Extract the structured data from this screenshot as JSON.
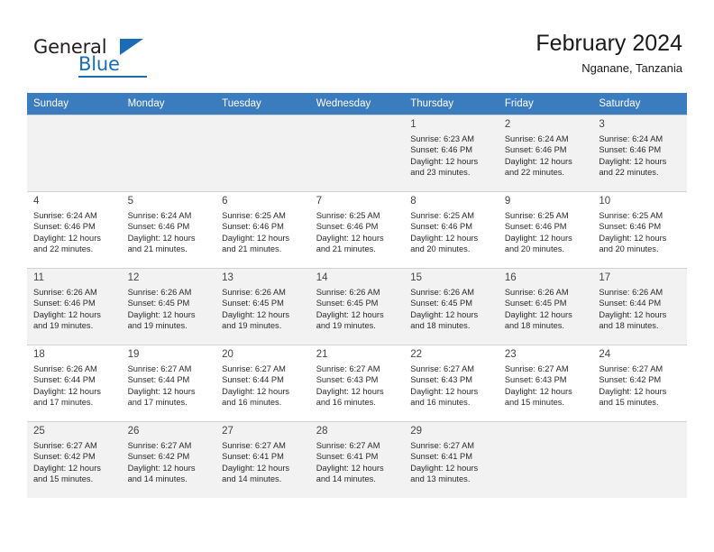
{
  "brand": {
    "name_top": "General",
    "name_bottom": "Blue",
    "accent_color": "#1b6cb5"
  },
  "header": {
    "title": "February 2024",
    "subtitle": "Nganane, Tanzania"
  },
  "calendar": {
    "header_bg": "#3a7cbe",
    "weekday_headers": [
      "Sunday",
      "Monday",
      "Tuesday",
      "Wednesday",
      "Thursday",
      "Friday",
      "Saturday"
    ],
    "weeks": [
      [
        {
          "day": "",
          "info": "",
          "empty": true
        },
        {
          "day": "",
          "info": "",
          "empty": true
        },
        {
          "day": "",
          "info": "",
          "empty": true
        },
        {
          "day": "",
          "info": "",
          "empty": true
        },
        {
          "day": "1",
          "info": "Sunrise: 6:23 AM\nSunset: 6:46 PM\nDaylight: 12 hours\nand 23 minutes."
        },
        {
          "day": "2",
          "info": "Sunrise: 6:24 AM\nSunset: 6:46 PM\nDaylight: 12 hours\nand 22 minutes."
        },
        {
          "day": "3",
          "info": "Sunrise: 6:24 AM\nSunset: 6:46 PM\nDaylight: 12 hours\nand 22 minutes."
        }
      ],
      [
        {
          "day": "4",
          "info": "Sunrise: 6:24 AM\nSunset: 6:46 PM\nDaylight: 12 hours\nand 22 minutes."
        },
        {
          "day": "5",
          "info": "Sunrise: 6:24 AM\nSunset: 6:46 PM\nDaylight: 12 hours\nand 21 minutes."
        },
        {
          "day": "6",
          "info": "Sunrise: 6:25 AM\nSunset: 6:46 PM\nDaylight: 12 hours\nand 21 minutes."
        },
        {
          "day": "7",
          "info": "Sunrise: 6:25 AM\nSunset: 6:46 PM\nDaylight: 12 hours\nand 21 minutes."
        },
        {
          "day": "8",
          "info": "Sunrise: 6:25 AM\nSunset: 6:46 PM\nDaylight: 12 hours\nand 20 minutes."
        },
        {
          "day": "9",
          "info": "Sunrise: 6:25 AM\nSunset: 6:46 PM\nDaylight: 12 hours\nand 20 minutes."
        },
        {
          "day": "10",
          "info": "Sunrise: 6:25 AM\nSunset: 6:46 PM\nDaylight: 12 hours\nand 20 minutes."
        }
      ],
      [
        {
          "day": "11",
          "info": "Sunrise: 6:26 AM\nSunset: 6:46 PM\nDaylight: 12 hours\nand 19 minutes."
        },
        {
          "day": "12",
          "info": "Sunrise: 6:26 AM\nSunset: 6:45 PM\nDaylight: 12 hours\nand 19 minutes."
        },
        {
          "day": "13",
          "info": "Sunrise: 6:26 AM\nSunset: 6:45 PM\nDaylight: 12 hours\nand 19 minutes."
        },
        {
          "day": "14",
          "info": "Sunrise: 6:26 AM\nSunset: 6:45 PM\nDaylight: 12 hours\nand 19 minutes."
        },
        {
          "day": "15",
          "info": "Sunrise: 6:26 AM\nSunset: 6:45 PM\nDaylight: 12 hours\nand 18 minutes."
        },
        {
          "day": "16",
          "info": "Sunrise: 6:26 AM\nSunset: 6:45 PM\nDaylight: 12 hours\nand 18 minutes."
        },
        {
          "day": "17",
          "info": "Sunrise: 6:26 AM\nSunset: 6:44 PM\nDaylight: 12 hours\nand 18 minutes."
        }
      ],
      [
        {
          "day": "18",
          "info": "Sunrise: 6:26 AM\nSunset: 6:44 PM\nDaylight: 12 hours\nand 17 minutes."
        },
        {
          "day": "19",
          "info": "Sunrise: 6:27 AM\nSunset: 6:44 PM\nDaylight: 12 hours\nand 17 minutes."
        },
        {
          "day": "20",
          "info": "Sunrise: 6:27 AM\nSunset: 6:44 PM\nDaylight: 12 hours\nand 16 minutes."
        },
        {
          "day": "21",
          "info": "Sunrise: 6:27 AM\nSunset: 6:43 PM\nDaylight: 12 hours\nand 16 minutes."
        },
        {
          "day": "22",
          "info": "Sunrise: 6:27 AM\nSunset: 6:43 PM\nDaylight: 12 hours\nand 16 minutes."
        },
        {
          "day": "23",
          "info": "Sunrise: 6:27 AM\nSunset: 6:43 PM\nDaylight: 12 hours\nand 15 minutes."
        },
        {
          "day": "24",
          "info": "Sunrise: 6:27 AM\nSunset: 6:42 PM\nDaylight: 12 hours\nand 15 minutes."
        }
      ],
      [
        {
          "day": "25",
          "info": "Sunrise: 6:27 AM\nSunset: 6:42 PM\nDaylight: 12 hours\nand 15 minutes."
        },
        {
          "day": "26",
          "info": "Sunrise: 6:27 AM\nSunset: 6:42 PM\nDaylight: 12 hours\nand 14 minutes."
        },
        {
          "day": "27",
          "info": "Sunrise: 6:27 AM\nSunset: 6:41 PM\nDaylight: 12 hours\nand 14 minutes."
        },
        {
          "day": "28",
          "info": "Sunrise: 6:27 AM\nSunset: 6:41 PM\nDaylight: 12 hours\nand 14 minutes."
        },
        {
          "day": "29",
          "info": "Sunrise: 6:27 AM\nSunset: 6:41 PM\nDaylight: 12 hours\nand 13 minutes."
        },
        {
          "day": "",
          "info": "",
          "empty": true
        },
        {
          "day": "",
          "info": "",
          "empty": true
        }
      ]
    ]
  }
}
